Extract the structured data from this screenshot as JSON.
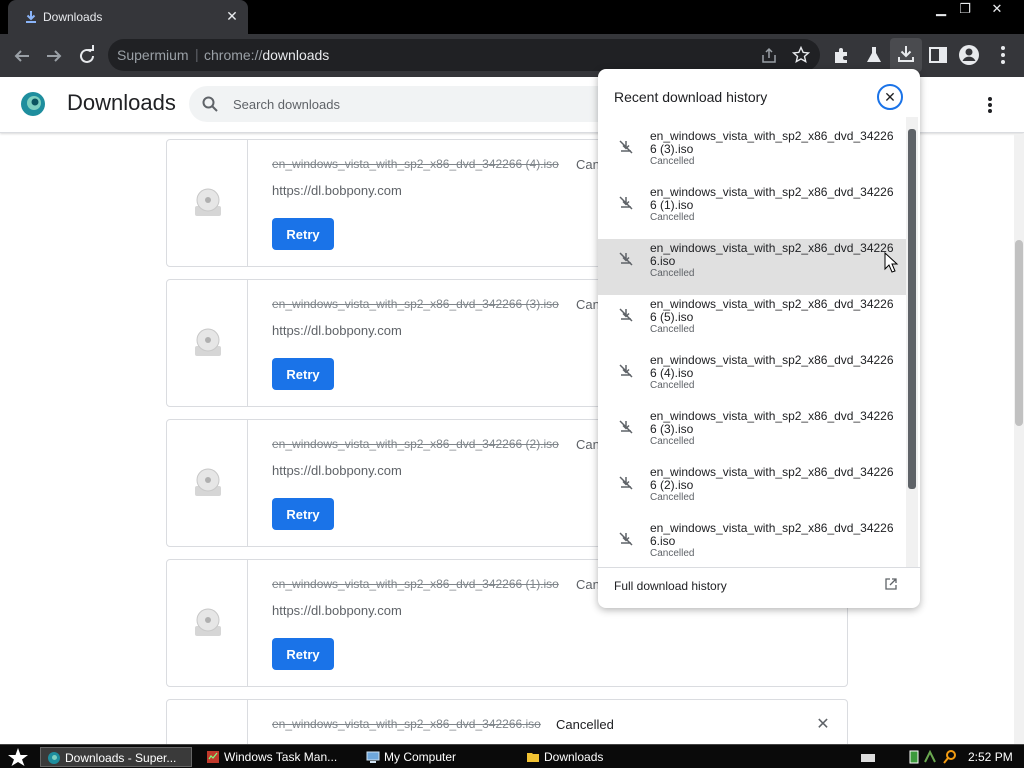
{
  "browser": {
    "tab_title": "Downloads",
    "omnibox_host": "Supermium",
    "omnibox_separator": "|",
    "omnibox_scheme": "chrome://",
    "omnibox_path": "downloads"
  },
  "page": {
    "title": "Downloads",
    "search_placeholder": "Search downloads"
  },
  "downloads": [
    {
      "filename": "en_windows_vista_with_sp2_x86_dvd_342266 (4).iso",
      "status": "Cancelled",
      "source": "https://dl.bobpony.com",
      "retry": "Retry"
    },
    {
      "filename": "en_windows_vista_with_sp2_x86_dvd_342266 (3).iso",
      "status": "Cancelled",
      "source": "https://dl.bobpony.com",
      "retry": "Retry"
    },
    {
      "filename": "en_windows_vista_with_sp2_x86_dvd_342266 (2).iso",
      "status": "Cancelled",
      "source": "https://dl.bobpony.com",
      "retry": "Retry"
    },
    {
      "filename": "en_windows_vista_with_sp2_x86_dvd_342266 (1).iso",
      "status": "Cancelled",
      "source": "https://dl.bobpony.com",
      "retry": "Retry"
    },
    {
      "filename": "en_windows_vista_with_sp2_x86_dvd_342266.iso",
      "status": "Cancelled"
    }
  ],
  "bubble": {
    "title": "Recent download history",
    "items": [
      {
        "name": "en_windows_vista_with_sp2_x86_dvd_342266 (3).iso",
        "status": "Cancelled"
      },
      {
        "name": "en_windows_vista_with_sp2_x86_dvd_342266 (1).iso",
        "status": "Cancelled"
      },
      {
        "name": "en_windows_vista_with_sp2_x86_dvd_342266.iso",
        "status": "Cancelled"
      },
      {
        "name": "en_windows_vista_with_sp2_x86_dvd_342266 (5).iso",
        "status": "Cancelled"
      },
      {
        "name": "en_windows_vista_with_sp2_x86_dvd_342266 (4).iso",
        "status": "Cancelled"
      },
      {
        "name": "en_windows_vista_with_sp2_x86_dvd_342266 (3).iso",
        "status": "Cancelled"
      },
      {
        "name": "en_windows_vista_with_sp2_x86_dvd_342266 (2).iso",
        "status": "Cancelled"
      },
      {
        "name": "en_windows_vista_with_sp2_x86_dvd_342266.iso",
        "status": "Cancelled"
      }
    ],
    "footer": "Full download history"
  },
  "taskbar": {
    "tasks": [
      {
        "label": "Downloads - Super...",
        "icon": "supermium-icon"
      },
      {
        "label": "Windows Task Man...",
        "icon": "task-manager-icon"
      },
      {
        "label": "My Computer",
        "icon": "computer-icon"
      },
      {
        "label": "Downloads",
        "icon": "folder-icon"
      }
    ],
    "clock": "2:52 PM"
  },
  "colors": {
    "accent": "#1a73e8",
    "toolbar": "#35363a",
    "titlebar": "#000000",
    "hover_row": "#e0e0e0"
  }
}
